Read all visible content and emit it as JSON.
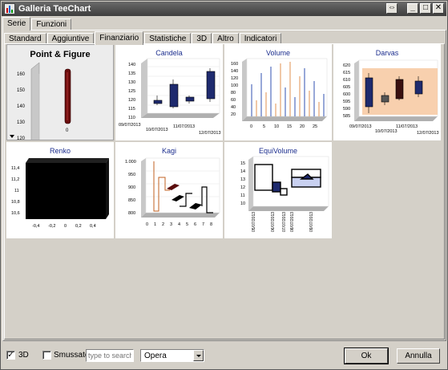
{
  "window": {
    "title": "Galleria TeeChart"
  },
  "titlebar_buttons": {
    "restore_down": "⇔",
    "minimize": "_",
    "maximize": "□",
    "close": "✕"
  },
  "outer_tabs": [
    {
      "label": "Serie"
    },
    {
      "label": "Funzioni"
    }
  ],
  "inner_tabs": [
    {
      "label": "Standard"
    },
    {
      "label": "Aggiuntive"
    },
    {
      "label": "Finanziario"
    },
    {
      "label": "Statistiche"
    },
    {
      "label": "3D"
    },
    {
      "label": "Altro"
    },
    {
      "label": "Indicatori"
    }
  ],
  "gallery": {
    "items": [
      {
        "title": "Point & Figure",
        "selected": true,
        "y_ticks": [
          "160",
          "150",
          "140",
          "130",
          "120"
        ],
        "x_ticks": [
          "0"
        ]
      },
      {
        "title": "Candela",
        "y_ticks": [
          "140",
          "135",
          "130",
          "125",
          "120",
          "115",
          "110"
        ],
        "x_ticks": [
          "09/07/2013",
          "10/07/2013",
          "11/07/2013",
          "12/07/2013"
        ]
      },
      {
        "title": "Volume",
        "y_ticks": [
          "160",
          "140",
          "120",
          "100",
          "80",
          "60",
          "40",
          "20"
        ],
        "x_ticks": [
          "0",
          "5",
          "10",
          "15",
          "20",
          "25"
        ]
      },
      {
        "title": "Darvas",
        "y_ticks": [
          "620",
          "615",
          "610",
          "605",
          "600",
          "595",
          "590",
          "585"
        ],
        "x_ticks": [
          "09/07/2013",
          "10/07/2013",
          "11/07/2013",
          "12/07/2013"
        ]
      },
      {
        "title": "Renko",
        "y_ticks": [
          "11,4",
          "11,2",
          "11",
          "10,8",
          "10,6"
        ],
        "x_ticks": [
          "-0,4",
          "-0,2",
          "0",
          "0,2",
          "0,4"
        ]
      },
      {
        "title": "Kagi",
        "y_ticks": [
          "1.000",
          "950",
          "900",
          "850",
          "800"
        ],
        "x_ticks": [
          "0",
          "1",
          "2",
          "3",
          "4",
          "5",
          "6",
          "7",
          "8"
        ]
      },
      {
        "title": "EquiVolume",
        "y_ticks": [
          "15",
          "14",
          "13",
          "12",
          "11",
          "10"
        ],
        "x_ticks": [
          "05/07/2013",
          "06/07/2013",
          "07/07/2013",
          "08/07/2013",
          "09/07/2013"
        ]
      }
    ]
  },
  "bottom": {
    "checkbox_3d": {
      "label": "3D",
      "checked": true,
      "mark": "✓"
    },
    "checkbox_smoothed": {
      "label": "Smussato",
      "checked": false
    },
    "search": {
      "placeholder": "type to search",
      "value": ""
    },
    "combo": {
      "value": "Opera"
    },
    "ok_label": "Ok",
    "cancel_label": "Annulla"
  },
  "colors": {
    "accent_title": "#1c2e8e",
    "series_dark_red": "#5a0c0c",
    "series_navy": "#1e2a6e"
  }
}
